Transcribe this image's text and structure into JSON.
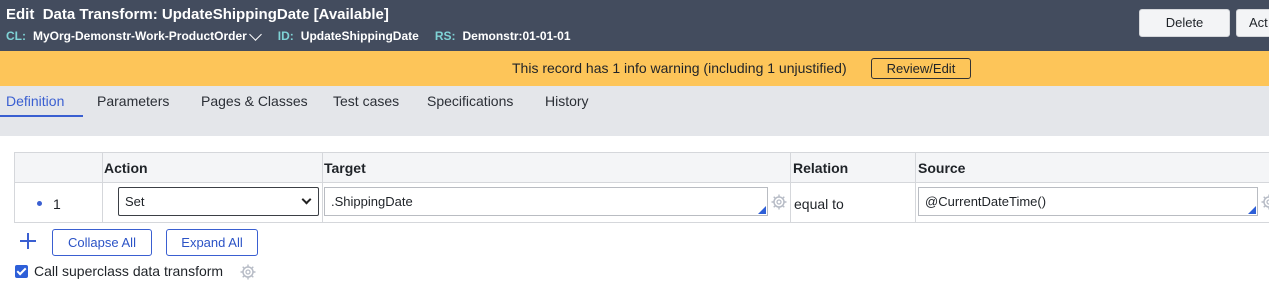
{
  "header": {
    "title_prefix": "Edit",
    "title": "Data Transform: UpdateShippingDate",
    "availability": "[Available]",
    "cl_key": "CL:",
    "cl_value": "MyOrg-Demonstr-Work-ProductOrder",
    "id_key": "ID:",
    "id_value": "UpdateShippingDate",
    "rs_key": "RS:",
    "rs_value": "Demonstr:01-01-01",
    "delete_label": "Delete",
    "actions_label": "Act"
  },
  "warning": {
    "message": "This record has 1 info warning (including 1 unjustified)",
    "review_label": "Review/Edit"
  },
  "tabs": [
    {
      "label": "Definition",
      "active": true
    },
    {
      "label": "Parameters",
      "active": false
    },
    {
      "label": "Pages & Classes",
      "active": false
    },
    {
      "label": "Test cases",
      "active": false
    },
    {
      "label": "Specifications",
      "active": false
    },
    {
      "label": "History",
      "active": false
    }
  ],
  "grid": {
    "columns": [
      "Action",
      "Target",
      "Relation",
      "Source"
    ],
    "rows": [
      {
        "number": "1",
        "action": "Set",
        "target": ".ShippingDate",
        "relation": "equal to",
        "source": "@CurrentDateTime()"
      }
    ]
  },
  "controls": {
    "collapse_label": "Collapse All",
    "expand_label": "Expand All",
    "superclass_label": "Call superclass data transform",
    "superclass_checked": true
  },
  "colors": {
    "header_bg": "#434c5e",
    "warning_bg": "#fdc559",
    "accent": "#3a5fd1",
    "meta_key": "#7fd3d6"
  }
}
